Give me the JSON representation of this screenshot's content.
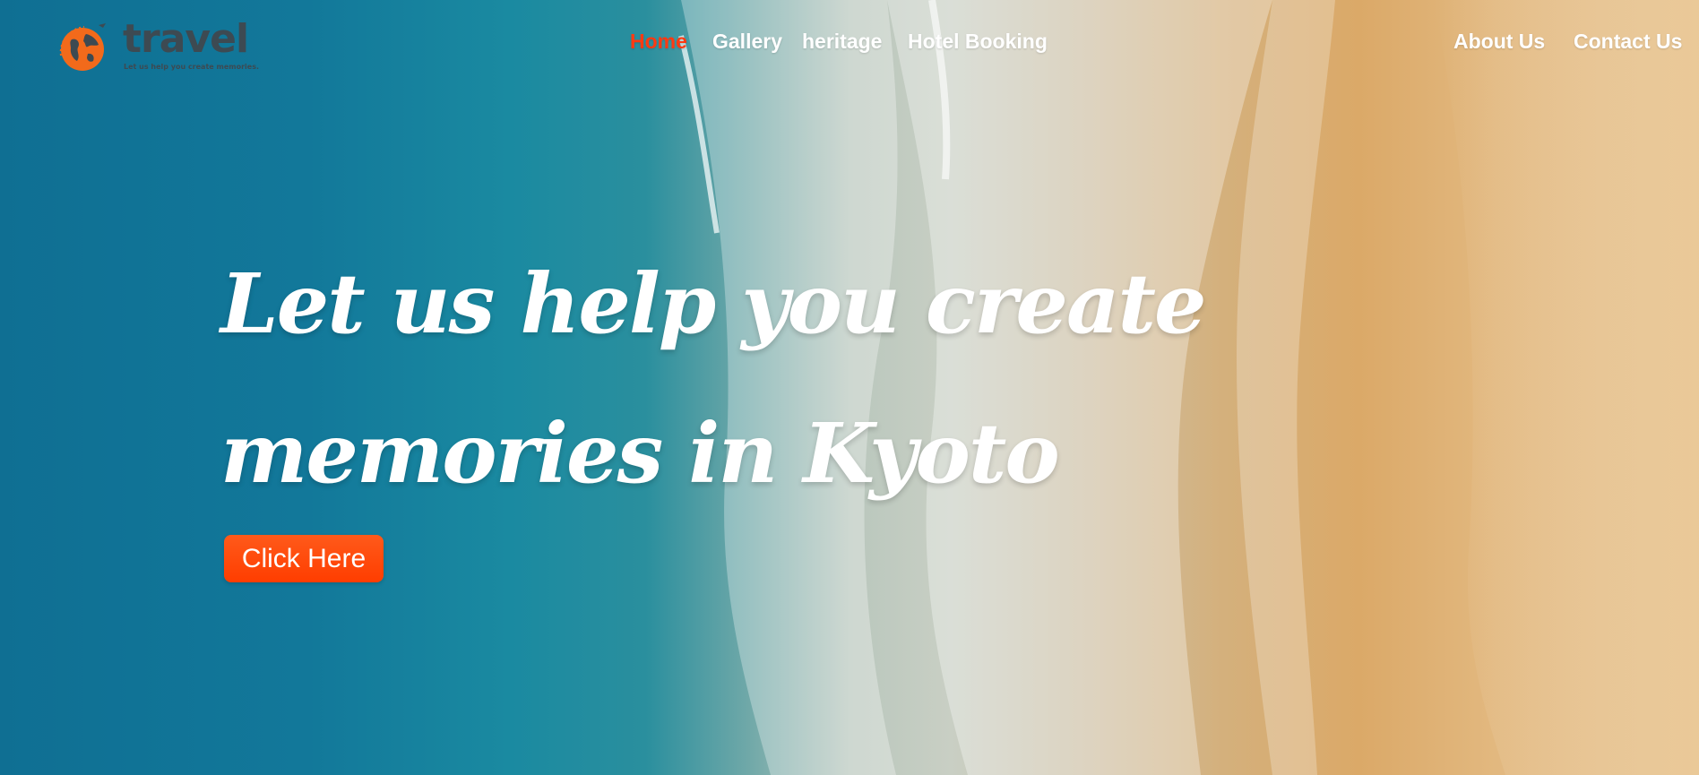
{
  "brand": {
    "name": "travel",
    "tagline": "Let us help you create memories.",
    "accent_color": "#f26a1b",
    "logo_icon": "globe-airplane-icon"
  },
  "nav": {
    "items": [
      {
        "label": "Home",
        "active": true
      },
      {
        "label": "Gallery"
      },
      {
        "label": "heritage"
      },
      {
        "label": "Hotel Booking"
      }
    ],
    "right_items": [
      {
        "label": "About Us"
      },
      {
        "label": "Contact Us"
      }
    ],
    "active_color": "#ff3a12"
  },
  "hero": {
    "headline_line1": "Let us help you create",
    "headline_line2": "memories in Kyoto",
    "cta_label": "Click Here",
    "cta_color": "#ff4500"
  }
}
